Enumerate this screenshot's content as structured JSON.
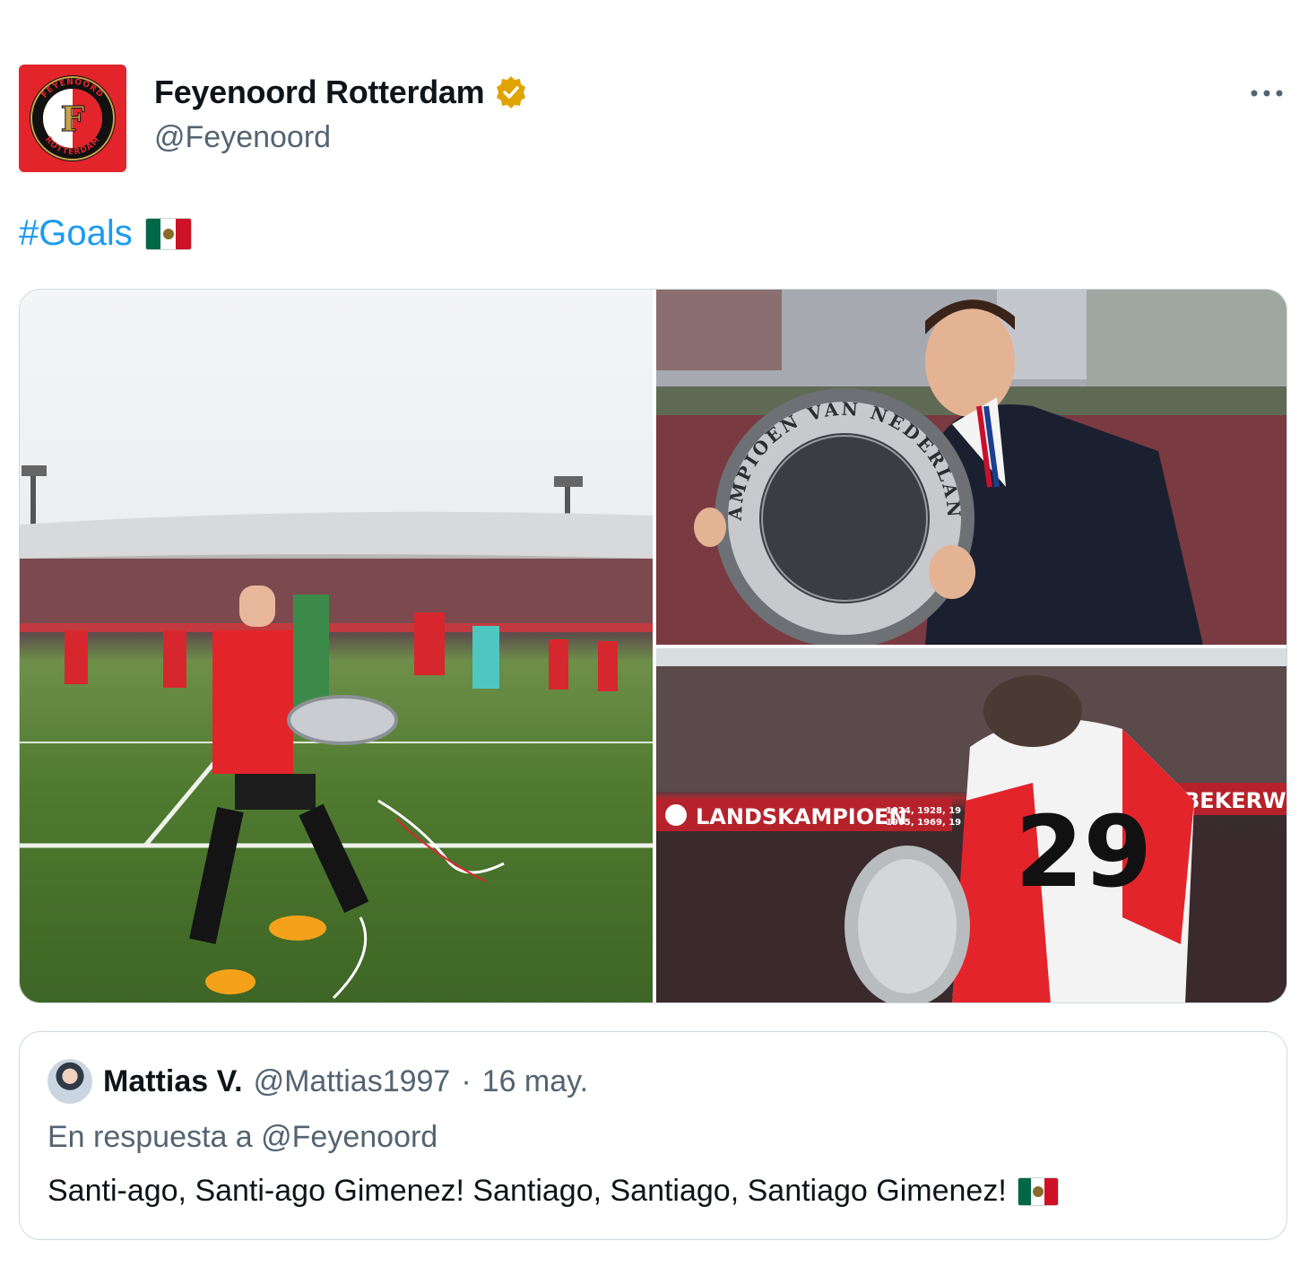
{
  "author": {
    "name": "Feyenoord Rotterdam",
    "handle": "@Feyenoord",
    "verified_icon": "verified-badge-gold",
    "logo_lettering": "FEYENOORD ROTTERDAM F"
  },
  "tweet": {
    "hashtag": "#Goals",
    "flag_emoji": "mexico-flag"
  },
  "media": {
    "photo_left_signage": "",
    "photo_top_right_signage": "KAMPIOEN VAN NEDERLAND",
    "photo_bottom_right_signage": "LANDSKAMPIOEN",
    "photo_bottom_right_years": "1924, 1928, 19",
    "photo_bottom_right_years_2": "1965, 1969, 19",
    "photo_bottom_right_banner2": "BEKERW",
    "photo_bottom_right_number": "29"
  },
  "quote": {
    "name": "Mattias V.",
    "handle": "@Mattias1997",
    "separator": "·",
    "date": "16 may.",
    "reply_to": "En respuesta a @Feyenoord",
    "text": "Santi-ago, Santi-ago Gimenez! Santiago, Santiago, Santiago Gimenez!"
  },
  "colors": {
    "link": "#1d9bf0",
    "secondary_text": "#536471",
    "border": "#cfd9de",
    "verified": "#e0a400",
    "brand_red": "#e3242b"
  }
}
